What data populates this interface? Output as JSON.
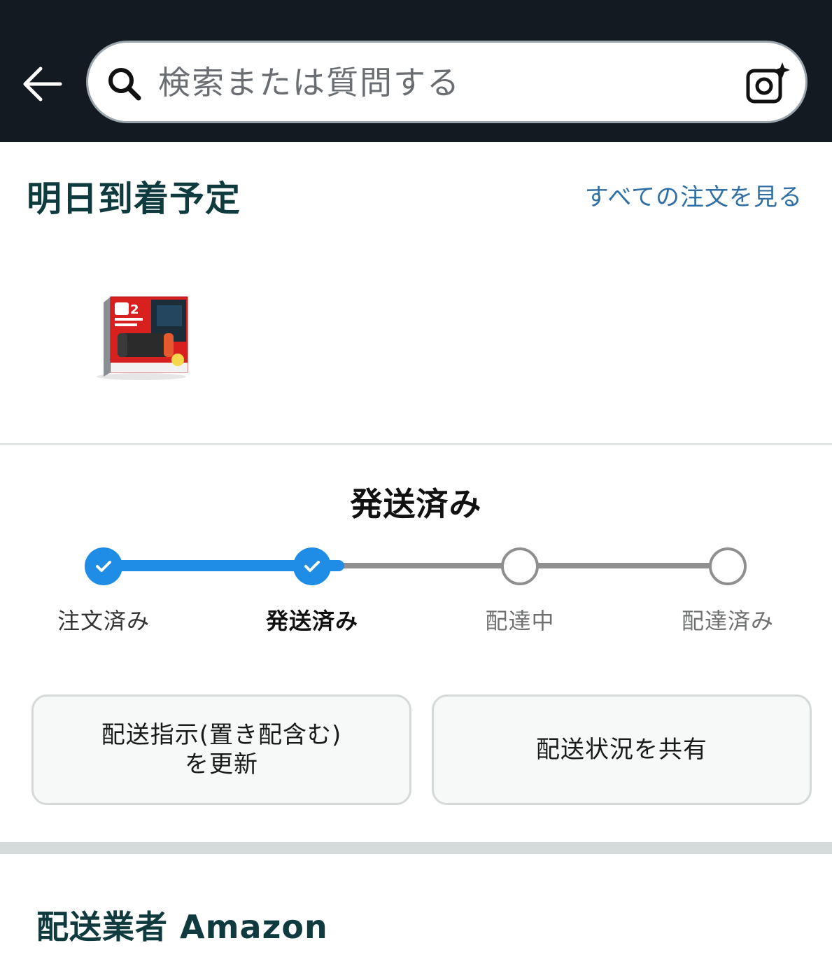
{
  "header": {
    "search_placeholder": "検索または質問する"
  },
  "arrival": {
    "title": "明日到着予定",
    "all_orders_link": "すべての注文を見る"
  },
  "status": {
    "title": "発送済み",
    "progress_completed_steps": 2,
    "steps": [
      {
        "label": "注文済み",
        "state": "done"
      },
      {
        "label": "発送済み",
        "state": "current"
      },
      {
        "label": "配達中",
        "state": "pending"
      },
      {
        "label": "配達済み",
        "state": "pending"
      }
    ]
  },
  "actions": {
    "update_delivery_line1": "配送指示(置き配含む)",
    "update_delivery_line2": "を更新",
    "share_status": "配送状況を共有"
  },
  "carrier": {
    "title": "配送業者 Amazon"
  },
  "colors": {
    "header_bg": "#131a22",
    "progress_blue": "#1f8ce6",
    "link_blue": "#2f6fa5",
    "title_teal": "#0f3b3f"
  }
}
